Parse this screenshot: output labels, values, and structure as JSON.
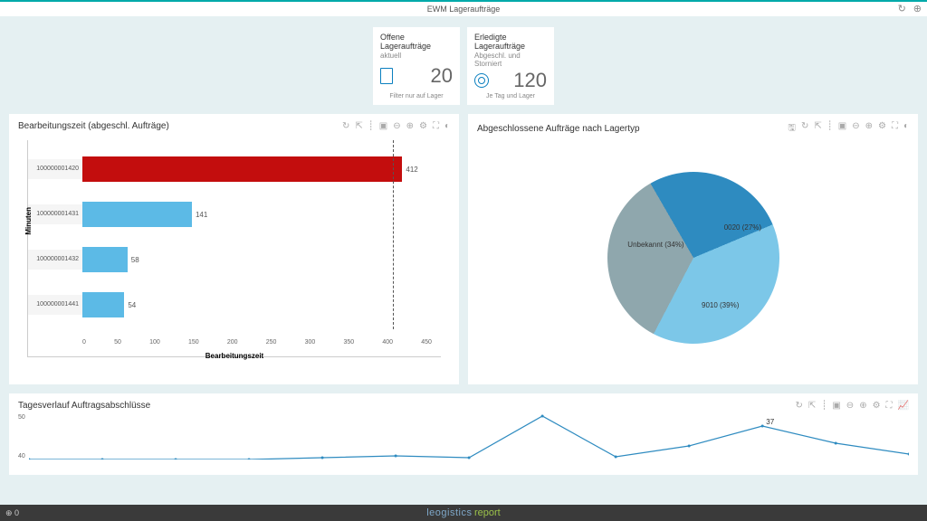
{
  "header": {
    "title": "EWM Lageraufträge"
  },
  "kpi": [
    {
      "title": "Offene Lageraufträge",
      "sub": "aktuell",
      "value": "20",
      "foot": "Filter nur auf Lager",
      "icon_color": "#0a7fbf"
    },
    {
      "title": "Erledigte Lageraufträge",
      "sub": "Abgeschl. und Storniert",
      "value": "120",
      "foot": "Je Tag und Lager",
      "icon_color": "#0a7fbf"
    }
  ],
  "bar_card": {
    "title": "Bearbeitungszeit (abgeschl. Aufträge)",
    "ylabel": "Minuten",
    "xlabel": "Bearbeitungszeit"
  },
  "pie_card": {
    "title": "Abgeschlossene Aufträge nach Lagertyp"
  },
  "line_card": {
    "title": "Tagesverlauf Auftragsabschlüsse"
  },
  "footer": {
    "left": "⊕ 0",
    "brand": "leogistics",
    "brand2": "report"
  },
  "chart_data": [
    {
      "type": "bar",
      "orientation": "horizontal",
      "title": "Bearbeitungszeit (abgeschl. Aufträge)",
      "xlabel": "Bearbeitungszeit",
      "ylabel": "Minuten",
      "xlim": [
        0,
        450
      ],
      "xticks": [
        0,
        50,
        100,
        150,
        200,
        250,
        300,
        350,
        400,
        450
      ],
      "reference_line": 400,
      "categories": [
        "100000001420",
        "100000001431",
        "100000001432",
        "100000001441"
      ],
      "values": [
        412,
        141,
        58,
        54
      ],
      "colors": [
        "#c30d0d",
        "#5cbae6",
        "#5cbae6",
        "#5cbae6"
      ]
    },
    {
      "type": "pie",
      "title": "Abgeschlossene Aufträge nach Lagertyp",
      "series": [
        {
          "name": "0020",
          "value": 27,
          "label": "0020 (27%)",
          "color": "#2e8bc0"
        },
        {
          "name": "9010",
          "value": 39,
          "label": "9010 (39%)",
          "color": "#7cc7e8"
        },
        {
          "name": "Unbekannt",
          "value": 34,
          "label": "Unbekannt (34%)",
          "color": "#8fa7ad"
        }
      ]
    },
    {
      "type": "line",
      "title": "Tagesverlauf Auftragsabschlüsse",
      "ylim": [
        0,
        50
      ],
      "yticks": [
        40,
        50
      ],
      "x": [
        0,
        1,
        2,
        3,
        4,
        5,
        6,
        7,
        8,
        9,
        10,
        11,
        12
      ],
      "values": [
        0,
        0,
        0,
        0,
        2,
        4,
        2,
        48,
        3,
        15,
        37,
        18,
        6
      ],
      "annotation": {
        "x": 10,
        "value": 37,
        "text": "37"
      }
    }
  ]
}
